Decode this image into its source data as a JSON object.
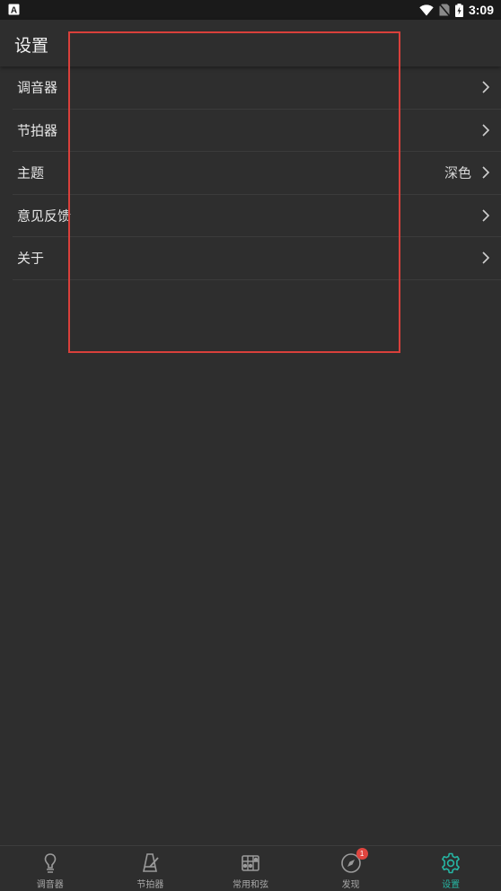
{
  "status_bar": {
    "time": "3:09",
    "left_icon": "a-notification-icon",
    "icons": [
      "wifi-icon",
      "no-sim-icon",
      "battery-charging-icon"
    ]
  },
  "header": {
    "title": "设置"
  },
  "settings": {
    "items": [
      {
        "label": "调音器",
        "value": "",
        "icon": "chevron-right-icon"
      },
      {
        "label": "节拍器",
        "value": "",
        "icon": "chevron-right-icon"
      },
      {
        "label": "主题",
        "value": "深色",
        "icon": "chevron-right-icon"
      },
      {
        "label": "意见反馈",
        "value": "",
        "icon": "chevron-right-icon"
      },
      {
        "label": "关于",
        "value": "",
        "icon": "chevron-right-icon"
      }
    ]
  },
  "bottom_nav": {
    "items": [
      {
        "label": "调音器",
        "icon": "tuner-icon",
        "active": false
      },
      {
        "label": "节拍器",
        "icon": "metronome-icon",
        "active": false
      },
      {
        "label": "常用和弦",
        "icon": "chord-icon",
        "active": false
      },
      {
        "label": "发现",
        "icon": "compass-icon",
        "active": false,
        "badge": "1"
      },
      {
        "label": "设置",
        "icon": "gear-icon",
        "active": true
      }
    ]
  },
  "colors": {
    "background": "#2e2e2e",
    "accent": "#26b5a3",
    "highlight_border": "#d9403b",
    "badge": "#e0453f"
  }
}
